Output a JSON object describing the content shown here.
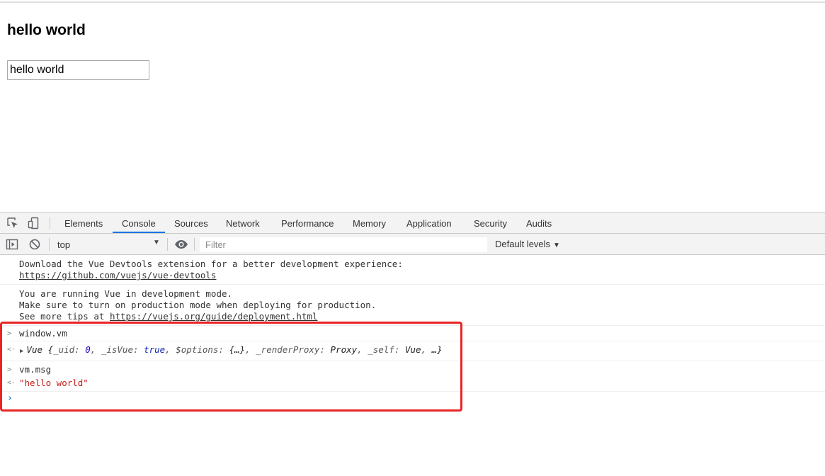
{
  "page": {
    "heading": "hello world",
    "input_value": "hello world"
  },
  "devtools": {
    "tabs": [
      "Elements",
      "Console",
      "Sources",
      "Network",
      "Performance",
      "Memory",
      "Application",
      "Security",
      "Audits"
    ],
    "active_tab": "Console",
    "toolbar": {
      "context": "top",
      "filter_placeholder": "Filter",
      "levels_label": "Default levels"
    },
    "console": {
      "devtools_msg_line1": "Download the Vue Devtools extension for a better development experience:",
      "devtools_msg_link": "https://github.com/vuejs/vue-devtools",
      "devmode_msg_line1": "You are running Vue in development mode.",
      "devmode_msg_line2": "Make sure to turn on production mode when deploying for production.",
      "devmode_msg_line3_prefix": "See more tips at ",
      "devmode_msg_link": "https://vuejs.org/guide/deployment.html",
      "input1": "window.vm",
      "output1": {
        "type_name": "Vue",
        "open_brace": " {",
        "uid_key": "_uid",
        "uid_val": "0",
        "isvue_key": "_isVue",
        "isvue_val": "true",
        "options_key": "$options",
        "options_val": "{…}",
        "render_key": "_renderProxy",
        "render_val": "Proxy",
        "self_key": "_self",
        "self_val": "Vue",
        "tail": "…}"
      },
      "input2": "vm.msg",
      "output2": "\"hello world\""
    }
  },
  "annotation": {
    "highlight_color": "#e82424"
  },
  "colors": {
    "accent": "#1a73e8",
    "string": "#c41a16",
    "number": "#1c00cf"
  }
}
